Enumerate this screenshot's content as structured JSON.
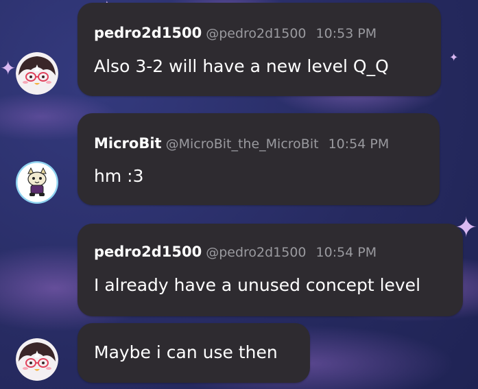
{
  "messages": [
    {
      "author": "pedro2d1500",
      "handle": "@pedro2d1500",
      "time": "10:53 PM",
      "text": "Also 3-2 will have a new level Q_Q",
      "avatar": "penguin-avatar-icon"
    },
    {
      "author": "MicroBit",
      "handle": "@MicroBit_the_MicroBit",
      "time": "10:54 PM",
      "text": "hm :3",
      "avatar": "cat-character-avatar-icon"
    },
    {
      "author": "pedro2d1500",
      "handle": "@pedro2d1500",
      "time": "10:54 PM",
      "text": "I already have a unused concept level",
      "avatar": "penguin-avatar-icon"
    },
    {
      "text": "Maybe i can use then",
      "avatar": "penguin-avatar-icon"
    }
  ],
  "colors": {
    "bubble": "#2e2b30",
    "background": "#2b2f6b",
    "name": "#ffffff",
    "meta": "#9a9a9f",
    "text": "#ffffff"
  }
}
